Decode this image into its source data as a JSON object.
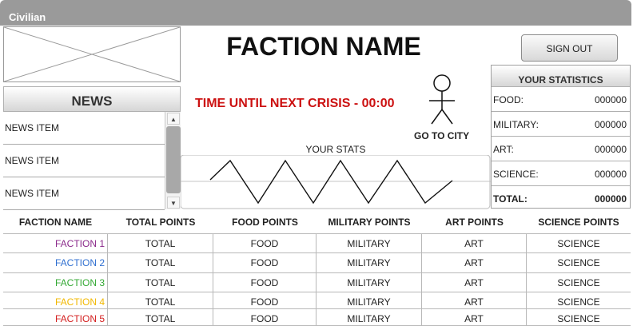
{
  "window": {
    "title": "Civilian"
  },
  "news": {
    "header": "NEWS",
    "items": [
      "NEWS ITEM",
      "NEWS ITEM",
      "NEWS ITEM"
    ]
  },
  "main": {
    "faction_name": "FACTION NAME",
    "crisis_timer": "TIME UNTIL NEXT CRISIS - 00:00",
    "go_to_city": "GO TO CITY",
    "your_stats_label": "YOUR STATS"
  },
  "header": {
    "sign_out": "SIGN OUT"
  },
  "statistics": {
    "title": "YOUR STATISTICS",
    "rows": [
      {
        "label": "FOOD:",
        "value": "000000"
      },
      {
        "label": "MILITARY:",
        "value": "000000"
      },
      {
        "label": "ART:",
        "value": "000000"
      },
      {
        "label": "SCIENCE:",
        "value": "000000"
      },
      {
        "label": "TOTAL:",
        "value": "000000"
      }
    ]
  },
  "table": {
    "columns": [
      "FACTION NAME",
      "TOTAL POINTS",
      "FOOD POINTS",
      "MILITARY POINTS",
      "ART POINTS",
      "SCIENCE POINTS"
    ],
    "rows": [
      {
        "faction": "FACTION 1",
        "color": "#8b2a8b",
        "total": "TOTAL",
        "food": "FOOD",
        "military": "MILITARY",
        "art": "ART",
        "science": "SCIENCE"
      },
      {
        "faction": "FACTION 2",
        "color": "#2f6fd0",
        "total": "TOTAL",
        "food": "FOOD",
        "military": "MILITARY",
        "art": "ART",
        "science": "SCIENCE"
      },
      {
        "faction": "FACTION 3",
        "color": "#33a833",
        "total": "TOTAL",
        "food": "FOOD",
        "military": "MILITARY",
        "art": "ART",
        "science": "SCIENCE"
      },
      {
        "faction": "FACTION 4",
        "color": "#f2b800",
        "total": "TOTAL",
        "food": "FOOD",
        "military": "MILITARY",
        "art": "ART",
        "science": "SCIENCE"
      },
      {
        "faction": "FACTION 5",
        "color": "#d42020",
        "total": "TOTAL",
        "food": "FOOD",
        "military": "MILITARY",
        "art": "ART",
        "science": "SCIENCE"
      }
    ]
  },
  "icons": {
    "scroll_up": "scroll-up-arrow-icon",
    "scroll_down": "scroll-down-arrow-icon",
    "avatar": "stick-figure-icon",
    "image_placeholder": "image-placeholder-icon"
  }
}
